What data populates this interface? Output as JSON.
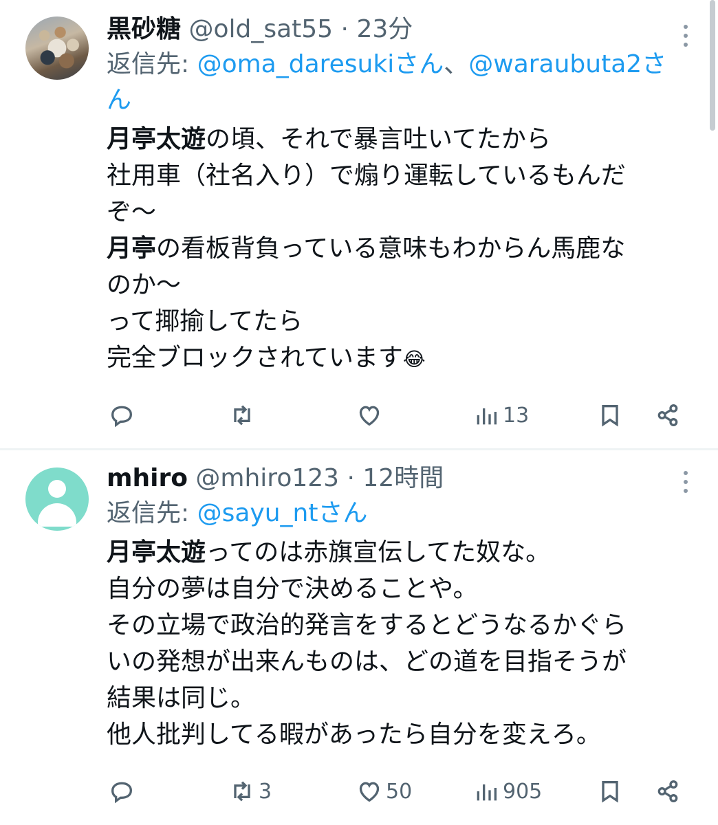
{
  "tweets": [
    {
      "name": "黒砂糖",
      "handle": "@old_sat55",
      "separator": "·",
      "time": "23分",
      "reply_prefix": "返信先: ",
      "reply_to_1": "@oma_daresukiさん",
      "reply_joiner": "、",
      "reply_to_2_a": "@waraubuta2さ",
      "reply_to_2_b": "ん",
      "lines": [
        {
          "bold": "月亭太遊",
          "text": "の頃、それで暴言吐いてたから"
        },
        {
          "bold": "",
          "text": "社用車（社名入り）で煽り運転しているもんだ"
        },
        {
          "bold": "",
          "text": "ぞ〜"
        },
        {
          "bold": "月亭",
          "text": "の看板背負っている意味もわからん馬鹿な"
        },
        {
          "bold": "",
          "text": "のか〜"
        },
        {
          "bold": "",
          "text": "って揶揄してたら"
        },
        {
          "bold": "",
          "text": "完全ブロックされています"
        }
      ],
      "emoji": "😂",
      "actions": {
        "reply_count": "",
        "retweet_count": "",
        "like_count": "",
        "views_count": "13"
      }
    },
    {
      "name": "mhiro",
      "handle": "@mhiro123",
      "separator": "·",
      "time": "12時間",
      "reply_prefix": "返信先: ",
      "reply_to_1": "@sayu_ntさん",
      "lines": [
        {
          "bold": "月亭太遊",
          "text": "ってのは赤旗宣伝してた奴な。"
        },
        {
          "bold": "",
          "text": "自分の夢は自分で決めることや。"
        },
        {
          "bold": "",
          "text": "その立場で政治的発言をするとどうなるかぐら"
        },
        {
          "bold": "",
          "text": "いの発想が出来んものは、どの道を目指そうが"
        },
        {
          "bold": "",
          "text": "結果は同じ。"
        },
        {
          "bold": "",
          "text": "他人批判してる暇があったら自分を変えろ。"
        }
      ],
      "actions": {
        "reply_count": "",
        "retweet_count": "3",
        "like_count": "50",
        "views_count": "905"
      }
    }
  ],
  "icons": {
    "reply": "reply-icon",
    "retweet": "retweet-icon",
    "like": "heart-icon",
    "views": "views-icon",
    "bookmark": "bookmark-icon",
    "share": "share-icon",
    "more": "more-icon"
  },
  "colors": {
    "mention": "#1d9bf0",
    "secondary_text": "#536471",
    "primary_text": "#0f1419",
    "default_avatar": "#7fdccb"
  }
}
